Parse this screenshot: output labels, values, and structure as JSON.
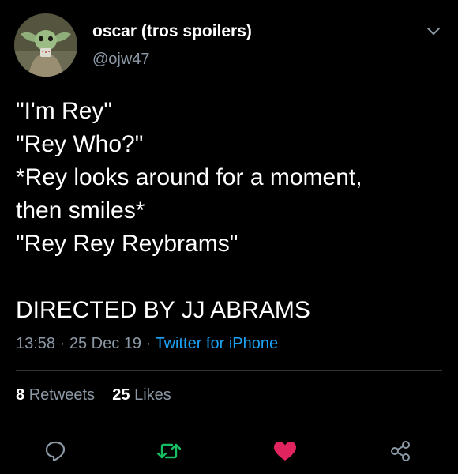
{
  "author": {
    "display_name": "oscar (tros spoilers)",
    "handle": "@ojw47"
  },
  "tweet": {
    "lines": [
      "\"I'm Rey\"",
      "\"Rey Who?\"",
      "*Rey looks around for a moment,",
      "then smiles*",
      "\"Rey Rey Reybrams\"",
      "DIRECTED BY JJ ABRAMS"
    ],
    "time": "13:58",
    "date": "25 Dec 19",
    "source": "Twitter for iPhone",
    "separator": "·"
  },
  "stats": {
    "retweets_count": "8",
    "retweets_label": "Retweets",
    "likes_count": "25",
    "likes_label": "Likes"
  },
  "icons": {
    "menu": "chevron-down-icon",
    "reply": "reply-icon",
    "retweet": "retweet-icon",
    "like": "heart-icon",
    "share": "share-icon"
  },
  "colors": {
    "background": "#000000",
    "text": "#ffffff",
    "secondary": "#8b98a5",
    "link": "#1da1f2",
    "retweet": "#17bf63",
    "like": "#e0245e",
    "divider": "#2f3336"
  }
}
